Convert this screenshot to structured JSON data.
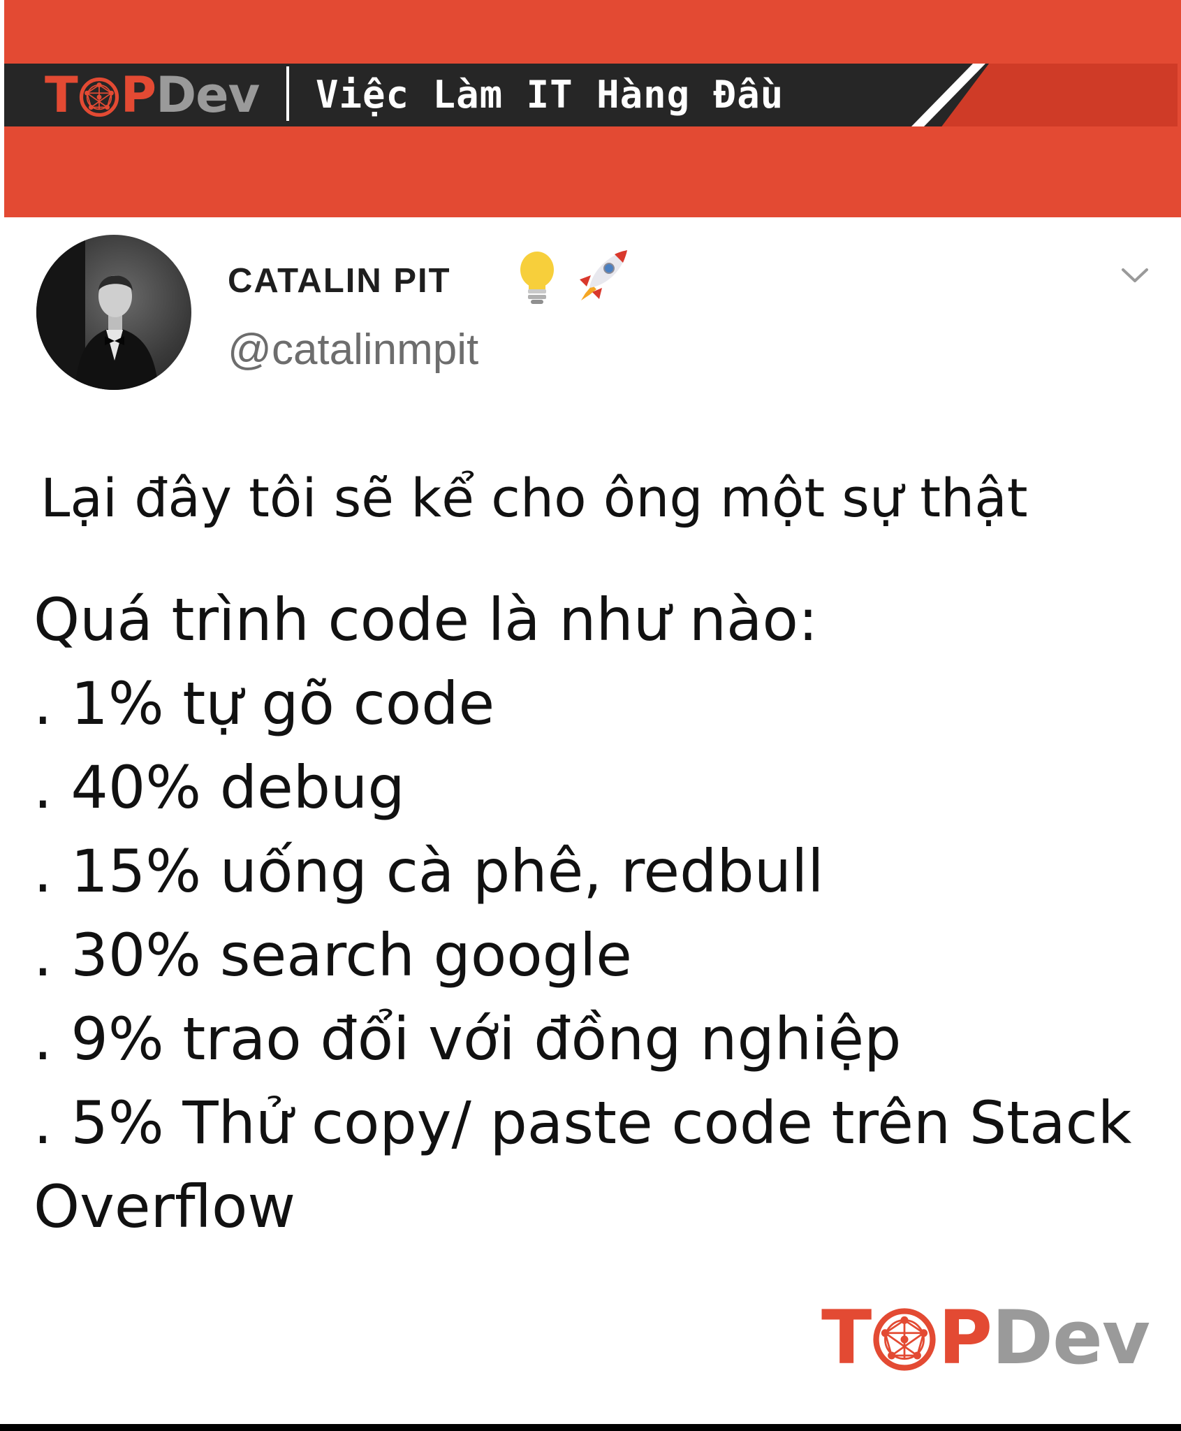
{
  "header": {
    "logo": {
      "t": "T",
      "p": "P",
      "dev": "Dev"
    },
    "tagline": "Việc Làm IT Hàng Đầu"
  },
  "tweet": {
    "author_name": "CATALIN PIT",
    "author_handle": "@catalinmpit",
    "intro": "Lại đây tôi sẽ kể cho ông một sự thật",
    "heading": "Quá trình code là như nào:",
    "items": [
      ". 1% tự gõ code",
      ". 40% debug",
      ". 15% uống cà phê, redbull",
      ". 30% search google",
      ". 9% trao đổi với đồng nghiệp",
      ". 5% Thử copy/ paste code trên Stack",
      "Overflow"
    ]
  },
  "footer": {
    "logo": {
      "t": "T",
      "p": "P",
      "dev": "Dev"
    }
  },
  "colors": {
    "brand_red": "#e34a33",
    "banner_dark": "#262626",
    "logo_grey": "#9a9a9a"
  },
  "icons": [
    "lightbulb-icon",
    "rocket-icon",
    "chevron-down-icon",
    "topdev-globe-icon"
  ]
}
